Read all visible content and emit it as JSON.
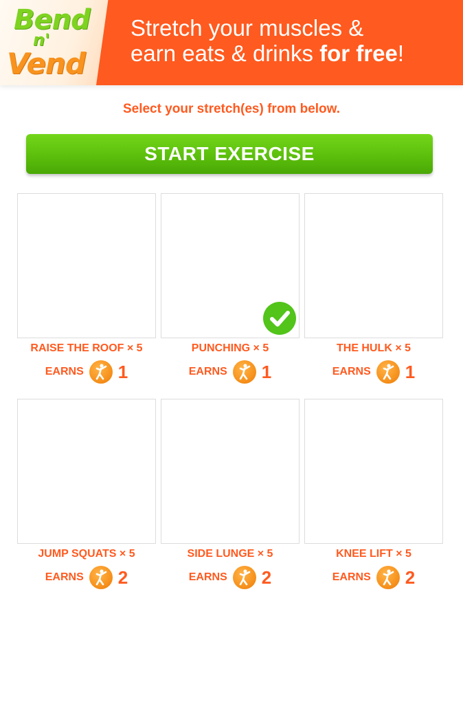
{
  "header": {
    "logo": {
      "line1": "Bend",
      "line2": "n'",
      "line3": "Vend"
    },
    "tagline_line1": "Stretch your muscles &",
    "tagline_line2_regular": "earn eats & drinks ",
    "tagline_line2_bold": "for free",
    "tagline_line2_end": "!"
  },
  "instruction": "Select your stretch(es) from below.",
  "start_button_label": "START EXERCISE",
  "exercises": [
    {
      "name": "RAISE THE ROOF × 5",
      "earns_label": "EARNS",
      "points": "1",
      "selected": false
    },
    {
      "name": "PUNCHING × 5",
      "earns_label": "EARNS",
      "points": "1",
      "selected": true
    },
    {
      "name": "THE HULK × 5",
      "earns_label": "EARNS",
      "points": "1",
      "selected": false
    },
    {
      "name": "JUMP SQUATS × 5",
      "earns_label": "EARNS",
      "points": "2",
      "selected": false
    },
    {
      "name": "SIDE LUNGE × 5",
      "earns_label": "EARNS",
      "points": "2",
      "selected": false
    },
    {
      "name": "KNEE LIFT × 5",
      "earns_label": "EARNS",
      "points": "2",
      "selected": false
    }
  ],
  "icons": {
    "coin": "stretching-person-coin-icon",
    "selected": "checkmark-icon"
  },
  "colors": {
    "brand_orange": "#ff5a1f",
    "button_green": "#5cbf0c",
    "check_green": "#52c41a",
    "coin_orange": "#f7931e",
    "logo_green": "#7ed321"
  }
}
